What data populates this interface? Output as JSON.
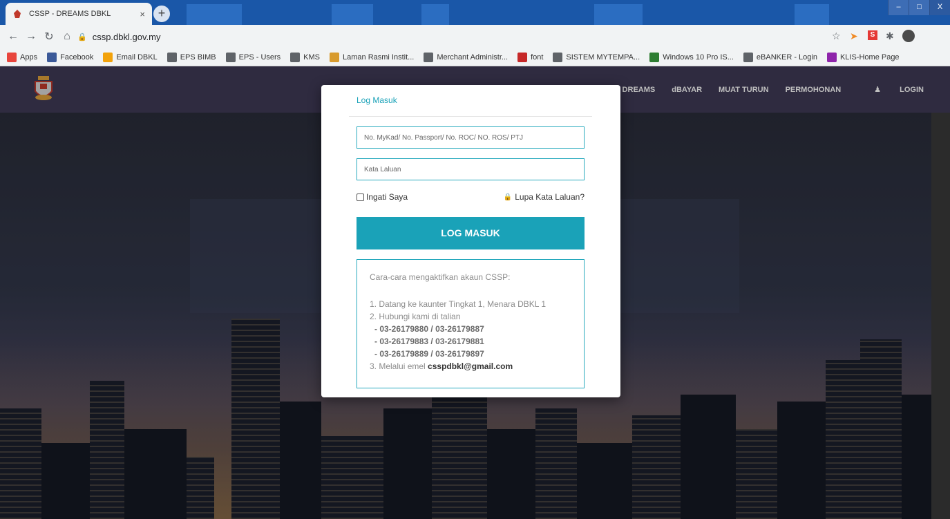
{
  "browser": {
    "tab_title": "CSSP - DREAMS DBKL",
    "tab_close": "×",
    "new_tab": "+",
    "url": "cssp.dbkl.gov.my",
    "win_min": "–",
    "win_max": "□",
    "win_close": "X",
    "bookmarks": [
      {
        "label": "Apps",
        "color": "#e8453c"
      },
      {
        "label": "Facebook",
        "color": "#3b5998"
      },
      {
        "label": "Email DBKL",
        "color": "#f2a20b"
      },
      {
        "label": "EPS BIMB",
        "color": "#5f6368"
      },
      {
        "label": "EPS - Users",
        "color": "#5f6368"
      },
      {
        "label": "KMS",
        "color": "#5f6368"
      },
      {
        "label": "Laman Rasmi Instit...",
        "color": "#d89b2e"
      },
      {
        "label": "Merchant Administr...",
        "color": "#5f6368"
      },
      {
        "label": "font",
        "color": "#c62828"
      },
      {
        "label": "SISTEM MYTEMPA...",
        "color": "#5f6368"
      },
      {
        "label": "Windows 10 Pro IS...",
        "color": "#2e7d32"
      },
      {
        "label": "eBANKER - Login",
        "color": "#5f6368"
      },
      {
        "label": "KLIS-Home Page",
        "color": "#8e24aa"
      }
    ]
  },
  "nav": {
    "items": [
      "TANG DREAMS",
      "dBAYAR",
      "MUAT TURUN",
      "PERMOHONAN",
      "LOGIN"
    ],
    "login_icon": "user-icon"
  },
  "modal": {
    "title": "Log Masuk",
    "id_placeholder": "No. MyKad/ No. Passport/ No. ROC/ NO. ROS/ PTJ",
    "pw_placeholder": "Kata Laluan",
    "remember": "Ingati Saya",
    "forgot": "Lupa Kata Laluan?",
    "login_button": "LOG MASUK",
    "info": {
      "heading": "Cara-cara mengaktifkan akaun CSSP:",
      "step1": "1. Datang ke kaunter Tingkat 1, Menara DBKL 1",
      "step2": "2. Hubungi kami di talian",
      "phones": [
        "- 03-26179880 / 03-26179887",
        "- 03-26179883 / 03-26179881",
        "- 03-26179889 / 03-26179897"
      ],
      "step3_prefix": "3. Melalui emel ",
      "email": "csspdbkl@gmail.com"
    }
  }
}
